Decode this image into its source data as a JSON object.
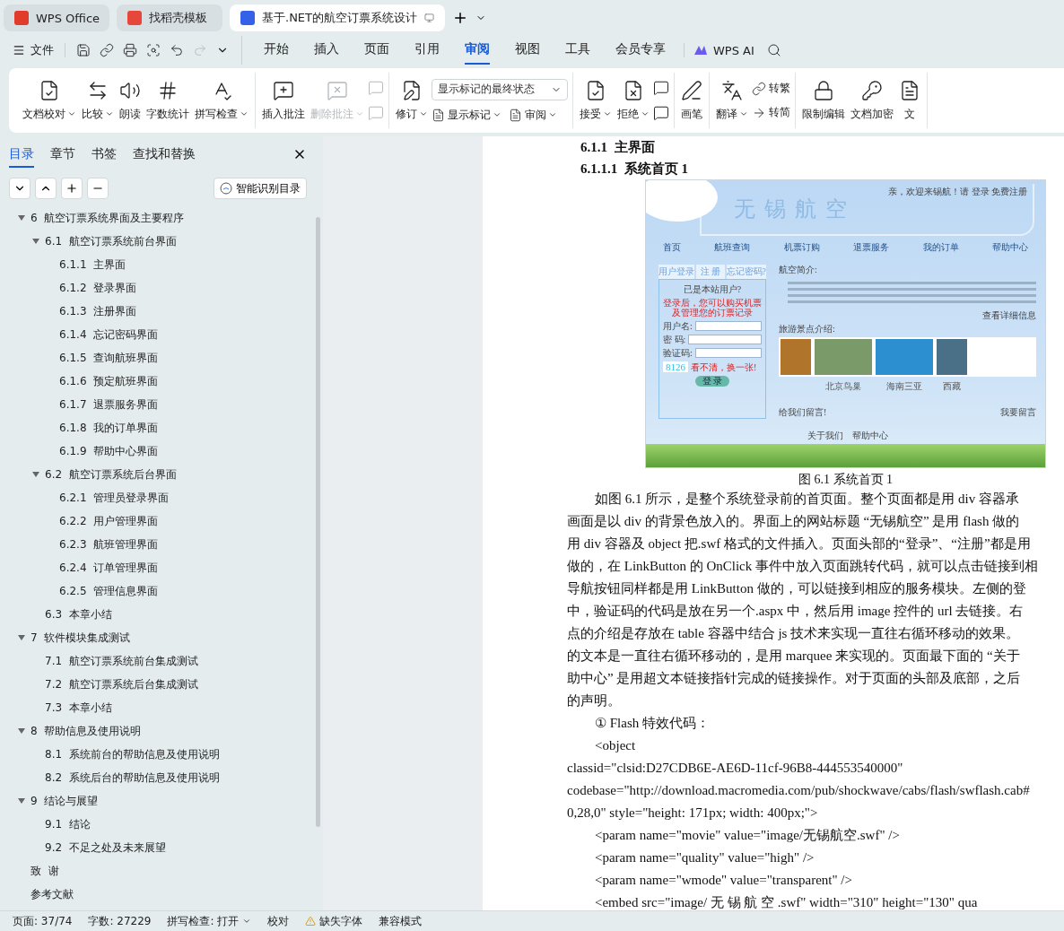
{
  "tabs": [
    {
      "label": "WPS Office",
      "selected": false
    },
    {
      "label": "找稻壳模板",
      "selected": false
    },
    {
      "label": "基于.NET的航空订票系统设计",
      "selected": true
    }
  ],
  "menu": {
    "file": "文件",
    "items": [
      {
        "label": "开始",
        "selected": false
      },
      {
        "label": "插入",
        "selected": false
      },
      {
        "label": "页面",
        "selected": false
      },
      {
        "label": "引用",
        "selected": false
      },
      {
        "label": "审阅",
        "selected": true
      },
      {
        "label": "视图",
        "selected": false
      },
      {
        "label": "工具",
        "selected": false
      },
      {
        "label": "会员专享",
        "selected": false
      }
    ],
    "ai": "WPS AI"
  },
  "ribbon": {
    "groups": [
      {
        "tools": [
          {
            "kind": "large",
            "label": "文档校对",
            "dropdown": true,
            "disabled": false
          },
          {
            "kind": "large",
            "label": "比较",
            "dropdown": true,
            "disabled": false
          },
          {
            "kind": "large",
            "label": "朗读",
            "dropdown": false,
            "disabled": false
          },
          {
            "kind": "large",
            "label": "字数统计",
            "dropdown": false,
            "disabled": false
          },
          {
            "kind": "large",
            "label": "拼写检查",
            "dropdown": true,
            "disabled": false
          }
        ]
      },
      {
        "tools": [
          {
            "kind": "large",
            "label": "插入批注",
            "dropdown": false,
            "disabled": false
          },
          {
            "kind": "large",
            "label": "删除批注",
            "dropdown": true,
            "disabled": true
          },
          {
            "kind": "icon_pair",
            "disabled": true
          }
        ]
      },
      {
        "tools": [
          {
            "kind": "large",
            "label": "修订",
            "dropdown": true,
            "disabled": false
          },
          {
            "kind": "select",
            "value": "显示标记的最终状态",
            "disabled": false,
            "items": [
              {
                "label": "显示标记",
                "dropdown": true
              },
              {
                "label": "审阅",
                "dropdown": true
              }
            ]
          }
        ]
      },
      {
        "tools": [
          {
            "kind": "large",
            "label": "接受",
            "dropdown": true,
            "disabled": false
          },
          {
            "kind": "large",
            "label": "拒绝",
            "dropdown": true,
            "disabled": false
          },
          {
            "kind": "icon_pair",
            "disabled": false
          }
        ]
      },
      {
        "tools": [
          {
            "kind": "large",
            "label": "画笔",
            "dropdown": false,
            "disabled": false
          }
        ]
      },
      {
        "tools": [
          {
            "kind": "large",
            "label": "翻译",
            "dropdown": true,
            "disabled": false
          },
          {
            "kind": "stack",
            "disabled": false,
            "items": [
              {
                "label": "转繁",
                "dropdown": false
              },
              {
                "label": "转简",
                "dropdown": false
              }
            ]
          }
        ]
      },
      {
        "tools": [
          {
            "kind": "large",
            "label": "限制编辑",
            "dropdown": false,
            "disabled": false
          },
          {
            "kind": "large",
            "label": "文档加密",
            "dropdown": false,
            "disabled": false
          },
          {
            "kind": "large",
            "label": "文",
            "dropdown": false,
            "disabled": false
          }
        ]
      }
    ]
  },
  "sidebar": {
    "tabs": [
      {
        "label": "目录",
        "selected": true
      },
      {
        "label": "章节",
        "selected": false
      },
      {
        "label": "书签",
        "selected": false
      },
      {
        "label": "查找和替换",
        "selected": false
      }
    ],
    "smart_button": "智能识别目录",
    "toc": [
      {
        "label": "6  航空订票系统界面及主要程序",
        "expanded": true,
        "children": [
          {
            "label": "6.1  航空订票系统前台界面",
            "expanded": true,
            "children": [
              {
                "label": "6.1.1  主界面"
              },
              {
                "label": "6.1.2  登录界面"
              },
              {
                "label": "6.1.3  注册界面"
              },
              {
                "label": "6.1.4  忘记密码界面"
              },
              {
                "label": "6.1.5  查询航班界面"
              },
              {
                "label": "6.1.6  预定航班界面"
              },
              {
                "label": "6.1.7  退票服务界面"
              },
              {
                "label": "6.1.8  我的订单界面"
              },
              {
                "label": "6.1.9  帮助中心界面"
              }
            ]
          },
          {
            "label": "6.2  航空订票系统后台界面",
            "expanded": true,
            "children": [
              {
                "label": "6.2.1  管理员登录界面"
              },
              {
                "label": "6.2.2  用户管理界面"
              },
              {
                "label": "6.2.3  航班管理界面"
              },
              {
                "label": "6.2.4  订单管理界面"
              },
              {
                "label": "6.2.5  管理信息界面"
              }
            ]
          },
          {
            "label": "6.3  本章小结"
          }
        ]
      },
      {
        "label": "7  软件模块集成测试",
        "expanded": true,
        "children": [
          {
            "label": "7.1  航空订票系统前台集成测试"
          },
          {
            "label": "7.2  航空订票系统后台集成测试"
          },
          {
            "label": "7.3  本章小结"
          }
        ]
      },
      {
        "label": "8  帮助信息及使用说明",
        "expanded": true,
        "children": [
          {
            "label": "8.1  系统前台的帮助信息及使用说明"
          },
          {
            "label": "8.2  系统后台的帮助信息及使用说明"
          }
        ]
      },
      {
        "label": "9  结论与展望",
        "expanded": true,
        "children": [
          {
            "label": "9.1  结论"
          },
          {
            "label": "9.2  不足之处及未来展望"
          }
        ]
      },
      {
        "label": "致  谢"
      },
      {
        "label": "参考文献"
      }
    ]
  },
  "document": {
    "headings": [
      {
        "number": "6.1.1",
        "title": "主界面"
      },
      {
        "number": "6.1.1.1",
        "title": "系统首页 1"
      }
    ],
    "figure": {
      "greeting": "亲，欢迎来锡航！请 登录 免费注册",
      "site_title": "无锡航空",
      "nav": [
        "首页",
        "航班查询",
        "机票订购",
        "退票服务",
        "我的订单",
        "帮助中心"
      ],
      "login_tabs": [
        "用户登录",
        "注 册",
        "忘记密码?"
      ],
      "login_prompt": "已是本站用户?",
      "login_notice": "登录后，您可以购买机票及管理您的订票记录",
      "fields": [
        "用户名:",
        "密 码:",
        "验证码:"
      ],
      "captcha": "8126",
      "captcha_refresh": "看不清，换一张!",
      "login_button": "登 录",
      "intro_title": "航空简介:",
      "more_link": "查看详细信息",
      "scenic_title": "旅游景点介绍:",
      "photos": [
        {
          "kind": "edge"
        },
        {
          "kind": "full",
          "caption": "北京鸟巢"
        },
        {
          "kind": "full",
          "caption": "海南三亚"
        },
        {
          "kind": "edge",
          "caption": "西藏"
        }
      ],
      "message_label": "给我们留言!",
      "message_link": "我要留言",
      "footer_links": [
        "关于我们",
        "帮助中心"
      ]
    },
    "caption": "图 6.1 系统首页 1",
    "paragraph_lines": [
      "如图 6.1 所示，是整个系统登录前的首页面。整个页面都是用 div 容器承",
      "画面是以 div 的背景色放入的。界面上的网站标题 “无锡航空” 是用 flash 做的",
      "用 div 容器及 object 把.swf 格式的文件插入。页面头部的“登录”、“注册”都是用",
      "做的，在 LinkButton 的 OnClick 事件中放入页面跳转代码，就可以点击链接到相",
      "导航按钮同样都是用 LinkButton 做的，可以链接到相应的服务模块。左侧的登",
      "中，验证码的代码是放在另一个.aspx 中，然后用 image 控件的 url 去链接。右",
      "点的介绍是存放在 table 容器中结合 js 技术来实现一直往右循环移动的效果。",
      "的文本是一直往右循环移动的，是用 marquee 来实现的。页面最下面的 “关于",
      "助中心” 是用超文本链接指针完成的链接操作。对于页面的头部及底部，之后",
      "的声明。"
    ],
    "code_lines": [
      {
        "kind": "indented",
        "text": "① Flash 特效代码："
      },
      {
        "kind": "indented",
        "text": "<object"
      },
      {
        "kind": "flush",
        "text": "classid=\"clsid:D27CDB6E-AE6D-11cf-96B8-444553540000\""
      },
      {
        "kind": "flush",
        "text": "codebase=\"http://download.macromedia.com/pub/shockwave/cabs/flash/swflash.cab#"
      },
      {
        "kind": "flush",
        "text": "0,28,0\" style=\"height: 171px; width: 400px;\">"
      },
      {
        "kind": "indented",
        "text": "<param name=\"movie\" value=\"image/无锡航空.swf\" />"
      },
      {
        "kind": "indented",
        "text": "<param name=\"quality\" value=\"high\" />"
      },
      {
        "kind": "indented",
        "text": "<param name=\"wmode\" value=\"transparent\" />"
      },
      {
        "kind": "indented",
        "text": "<embed src=\"image/ 无 锡 航 空 .swf\" width=\"310\" height=\"130\" qua"
      }
    ]
  },
  "status_bar": {
    "page": "页面: 37/74",
    "words": "字数: 27229",
    "spell": "拼写检查: 打开",
    "proof": "校对",
    "missing_fonts": "缺失字体",
    "compat": "兼容模式"
  }
}
